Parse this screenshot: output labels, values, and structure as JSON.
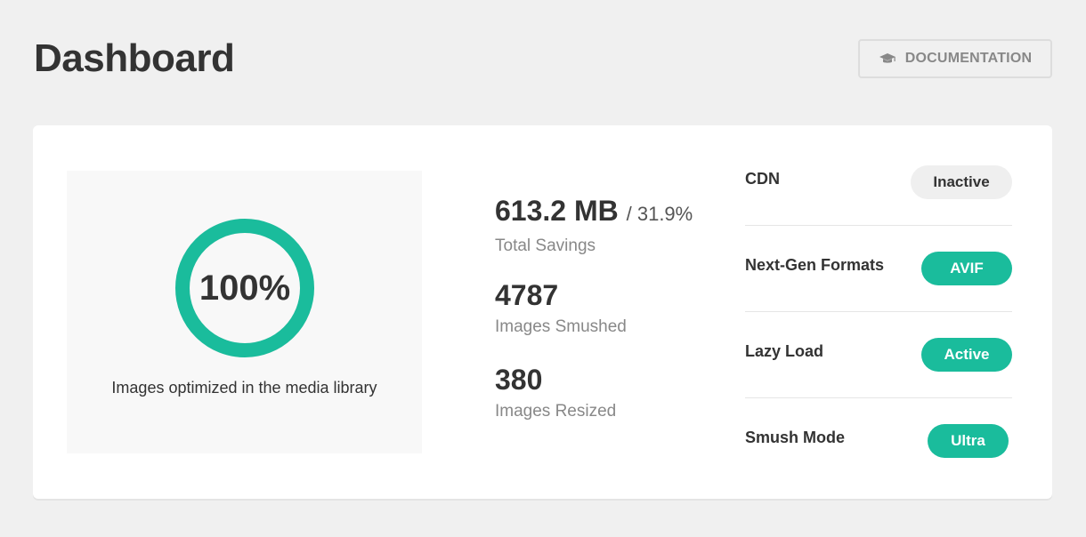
{
  "header": {
    "title": "Dashboard",
    "documentation_label": "DOCUMENTATION",
    "documentation_icon": "graduation-cap-icon"
  },
  "score": {
    "value": "100%",
    "percent": 100,
    "caption": "Images optimized in the media library",
    "ring_color": "#1abc9c"
  },
  "stats": {
    "savings": {
      "value": "613.2 MB",
      "percent": "/ 31.9%",
      "label": "Total Savings"
    },
    "smushed": {
      "value": "4787",
      "label": "Images Smushed"
    },
    "resized": {
      "value": "380",
      "label": "Images Resized"
    }
  },
  "settings": {
    "cdn": {
      "label": "CDN",
      "status": "Inactive"
    },
    "next_gen": {
      "label": "Next-Gen Formats",
      "status": "AVIF"
    },
    "lazy_load": {
      "label": "Lazy Load",
      "status": "Active"
    },
    "smush_mode": {
      "label": "Smush Mode",
      "status": "Ultra"
    }
  },
  "colors": {
    "accent": "#1abc9c",
    "background": "#f0f0f0",
    "text": "#333333",
    "muted": "#888888"
  }
}
